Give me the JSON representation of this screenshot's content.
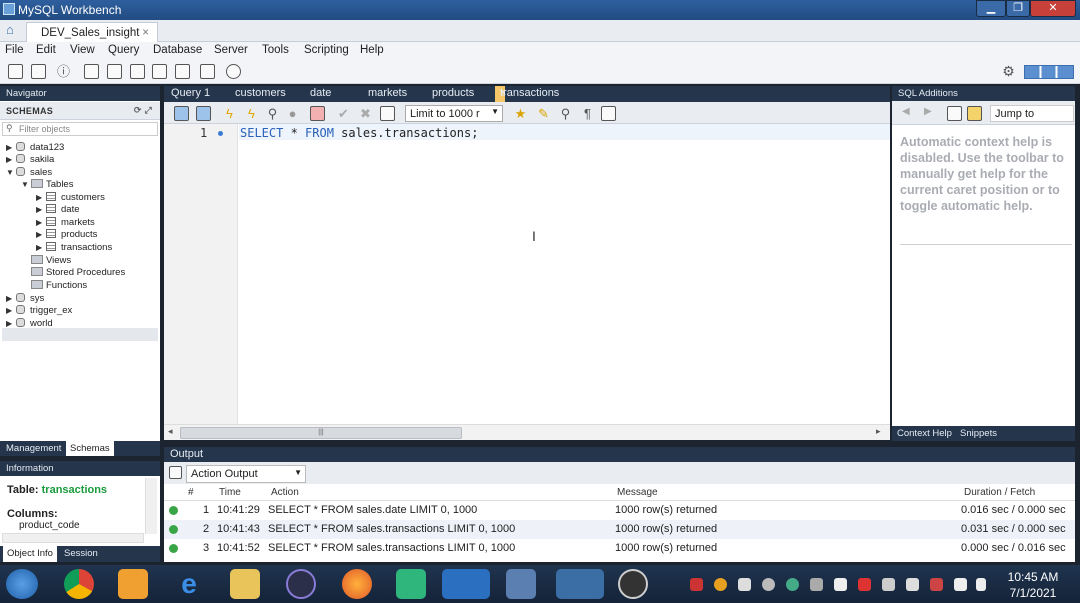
{
  "window": {
    "title": "MySQL Workbench",
    "connection_tab": "DEV_Sales_insight",
    "close_glyph": "×"
  },
  "menu": [
    "File",
    "Edit",
    "View",
    "Query",
    "Database",
    "Server",
    "Tools",
    "Scripting",
    "Help"
  ],
  "navigator": {
    "header": "Navigator",
    "schemas_label": "SCHEMAS",
    "filter_placeholder": "Filter objects",
    "tree": {
      "data123": "data123",
      "sakila": "sakila",
      "sales": "sales",
      "tables": "Tables",
      "customers": "customers",
      "date": "date",
      "markets": "markets",
      "products": "products",
      "transactions": "transactions",
      "views": "Views",
      "stored_procedures": "Stored Procedures",
      "functions": "Functions",
      "sys": "sys",
      "trigger_ex": "trigger_ex",
      "world": "world"
    },
    "tabs": {
      "management": "Management",
      "schemas": "Schemas"
    }
  },
  "information": {
    "header": "Information",
    "table_label": "Table:",
    "table_name": "transactions",
    "columns_label": "Columns:",
    "column_first": "product_code",
    "tabs": {
      "object_info": "Object Info",
      "session": "Session"
    }
  },
  "query_tabs": [
    "Query 1",
    "customers",
    "date",
    "markets",
    "products",
    "transactions"
  ],
  "active_tab_close": "×",
  "editor": {
    "limit_label": "Limit to 1000 r",
    "line_number": "1",
    "sql": {
      "kw1": "SELECT",
      "star": " * ",
      "kw2": "FROM",
      "rest": " sales.transactions;"
    }
  },
  "sql_additions": {
    "header": "SQL Additions",
    "jump_to": "Jump to",
    "help_text": "Automatic context help is disabled. Use the toolbar to manually get help for the current caret position or to toggle automatic help.",
    "tabs": {
      "context_help": "Context Help",
      "snippets": "Snippets"
    }
  },
  "output": {
    "header": "Output",
    "selector": "Action Output",
    "columns": {
      "num": "#",
      "time": "Time",
      "action": "Action",
      "message": "Message",
      "duration": "Duration / Fetch"
    },
    "rows": [
      {
        "num": "1",
        "time": "10:41:29",
        "action": "SELECT * FROM sales.date LIMIT 0, 1000",
        "message": "1000 row(s) returned",
        "duration": "0.016 sec / 0.000 sec"
      },
      {
        "num": "2",
        "time": "10:41:43",
        "action": "SELECT * FROM sales.transactions LIMIT 0, 1000",
        "message": "1000 row(s) returned",
        "duration": "0.031 sec / 0.000 sec"
      },
      {
        "num": "3",
        "time": "10:41:52",
        "action": "SELECT * FROM sales.transactions LIMIT 0, 1000",
        "message": "1000 row(s) returned",
        "duration": "0.000 sec / 0.016 sec"
      }
    ]
  },
  "taskbar": {
    "time": "10:45 AM",
    "date": "7/1/2021"
  },
  "colors": {
    "panel_header": "#24354c",
    "active_tab": "#f5c769",
    "ok_status": "#3aa547",
    "keyword": "#2a60b9"
  }
}
